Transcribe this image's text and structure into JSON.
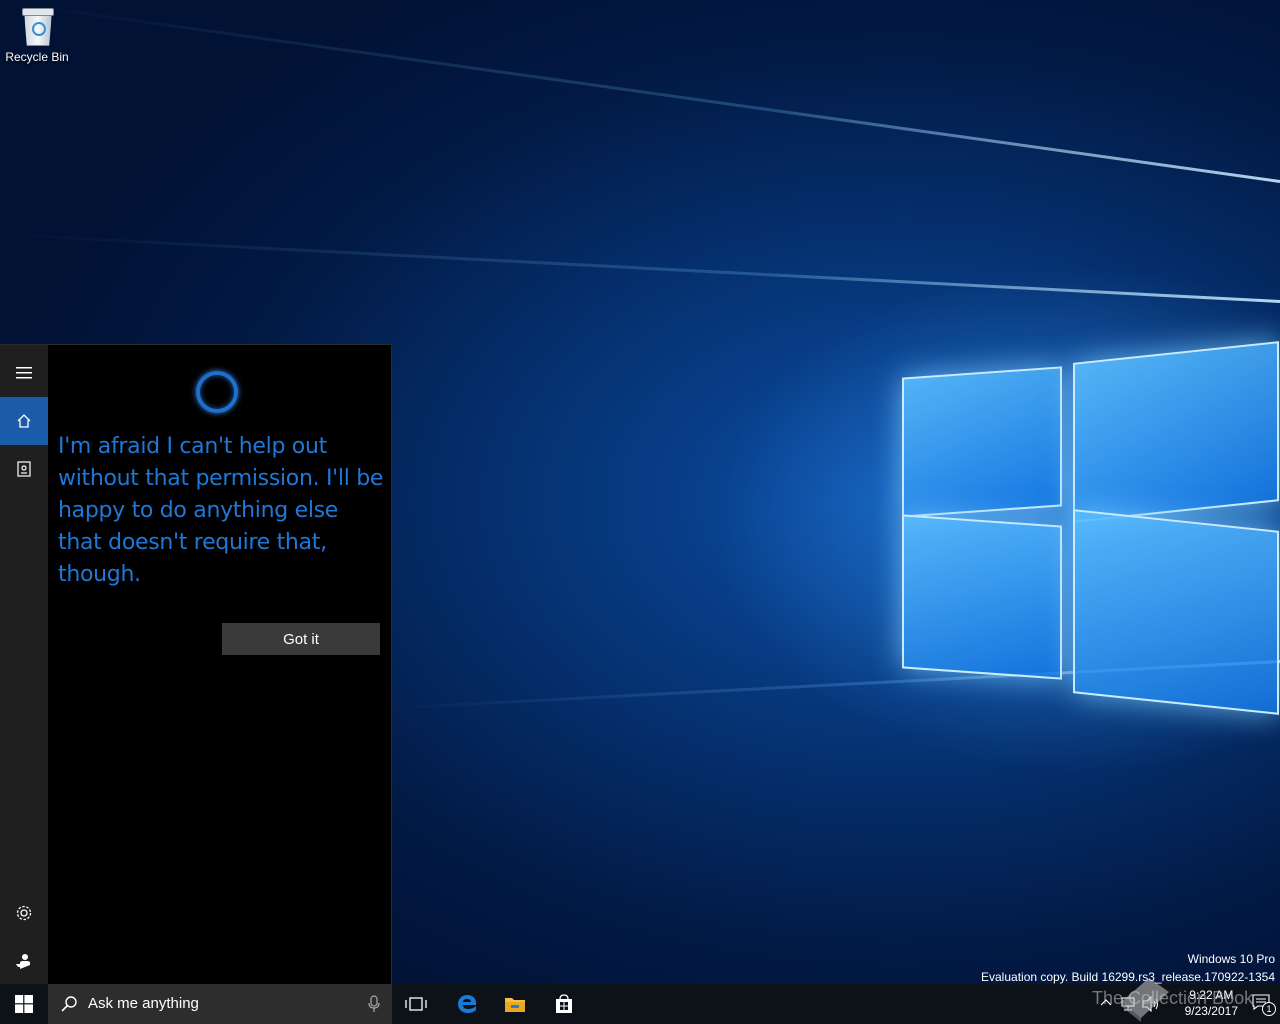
{
  "desktop": {
    "icons": [
      {
        "label": "Recycle Bin",
        "icon": "recycle-bin-icon"
      }
    ],
    "watermark": {
      "edition": "Windows 10 Pro",
      "build": "Evaluation copy. Build 16299.rs3_release.170922-1354"
    }
  },
  "cortana": {
    "rail": {
      "menu_icon": "hamburger-icon",
      "home_icon": "home-icon",
      "notebook_icon": "notebook-icon",
      "settings_icon": "gear-icon",
      "feedback_icon": "feedback-icon"
    },
    "message": "I'm afraid I can't help out without that permission. I'll be happy to do anything else that doesn't require that, though.",
    "button_label": "Got it"
  },
  "taskbar": {
    "search_placeholder": "Ask me anything",
    "pinned": [
      "task-view-icon",
      "edge-icon",
      "file-explorer-icon",
      "store-icon"
    ],
    "clock": {
      "time": "9:22 AM",
      "date": "9/23/2017"
    },
    "notification_count": "1"
  },
  "overlay": {
    "text": "The Collection Book"
  },
  "colors": {
    "accent": "#1a5ca8",
    "cortana_text": "#1f78d6",
    "taskbar": "#0d1118"
  }
}
